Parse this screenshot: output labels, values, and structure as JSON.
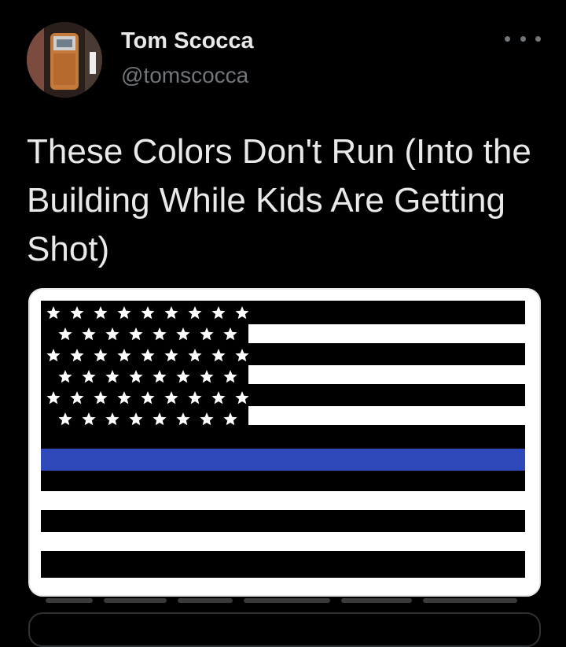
{
  "tweet": {
    "author": {
      "display_name": "Tom Scocca",
      "handle": "@tomscocca",
      "avatar_icon": "avatar-photo"
    },
    "more_icon": "more-horizontal-icon",
    "text": "These Colors Don't Run (Into the Building While Kids Are Getting Shot)"
  },
  "media": {
    "icon": "thin-blue-line-flag-image",
    "colors": {
      "stripe_black": "#000000",
      "stripe_white": "#ffffff",
      "thin_blue_line": "#2f49b8",
      "star": "#ffffff"
    }
  }
}
